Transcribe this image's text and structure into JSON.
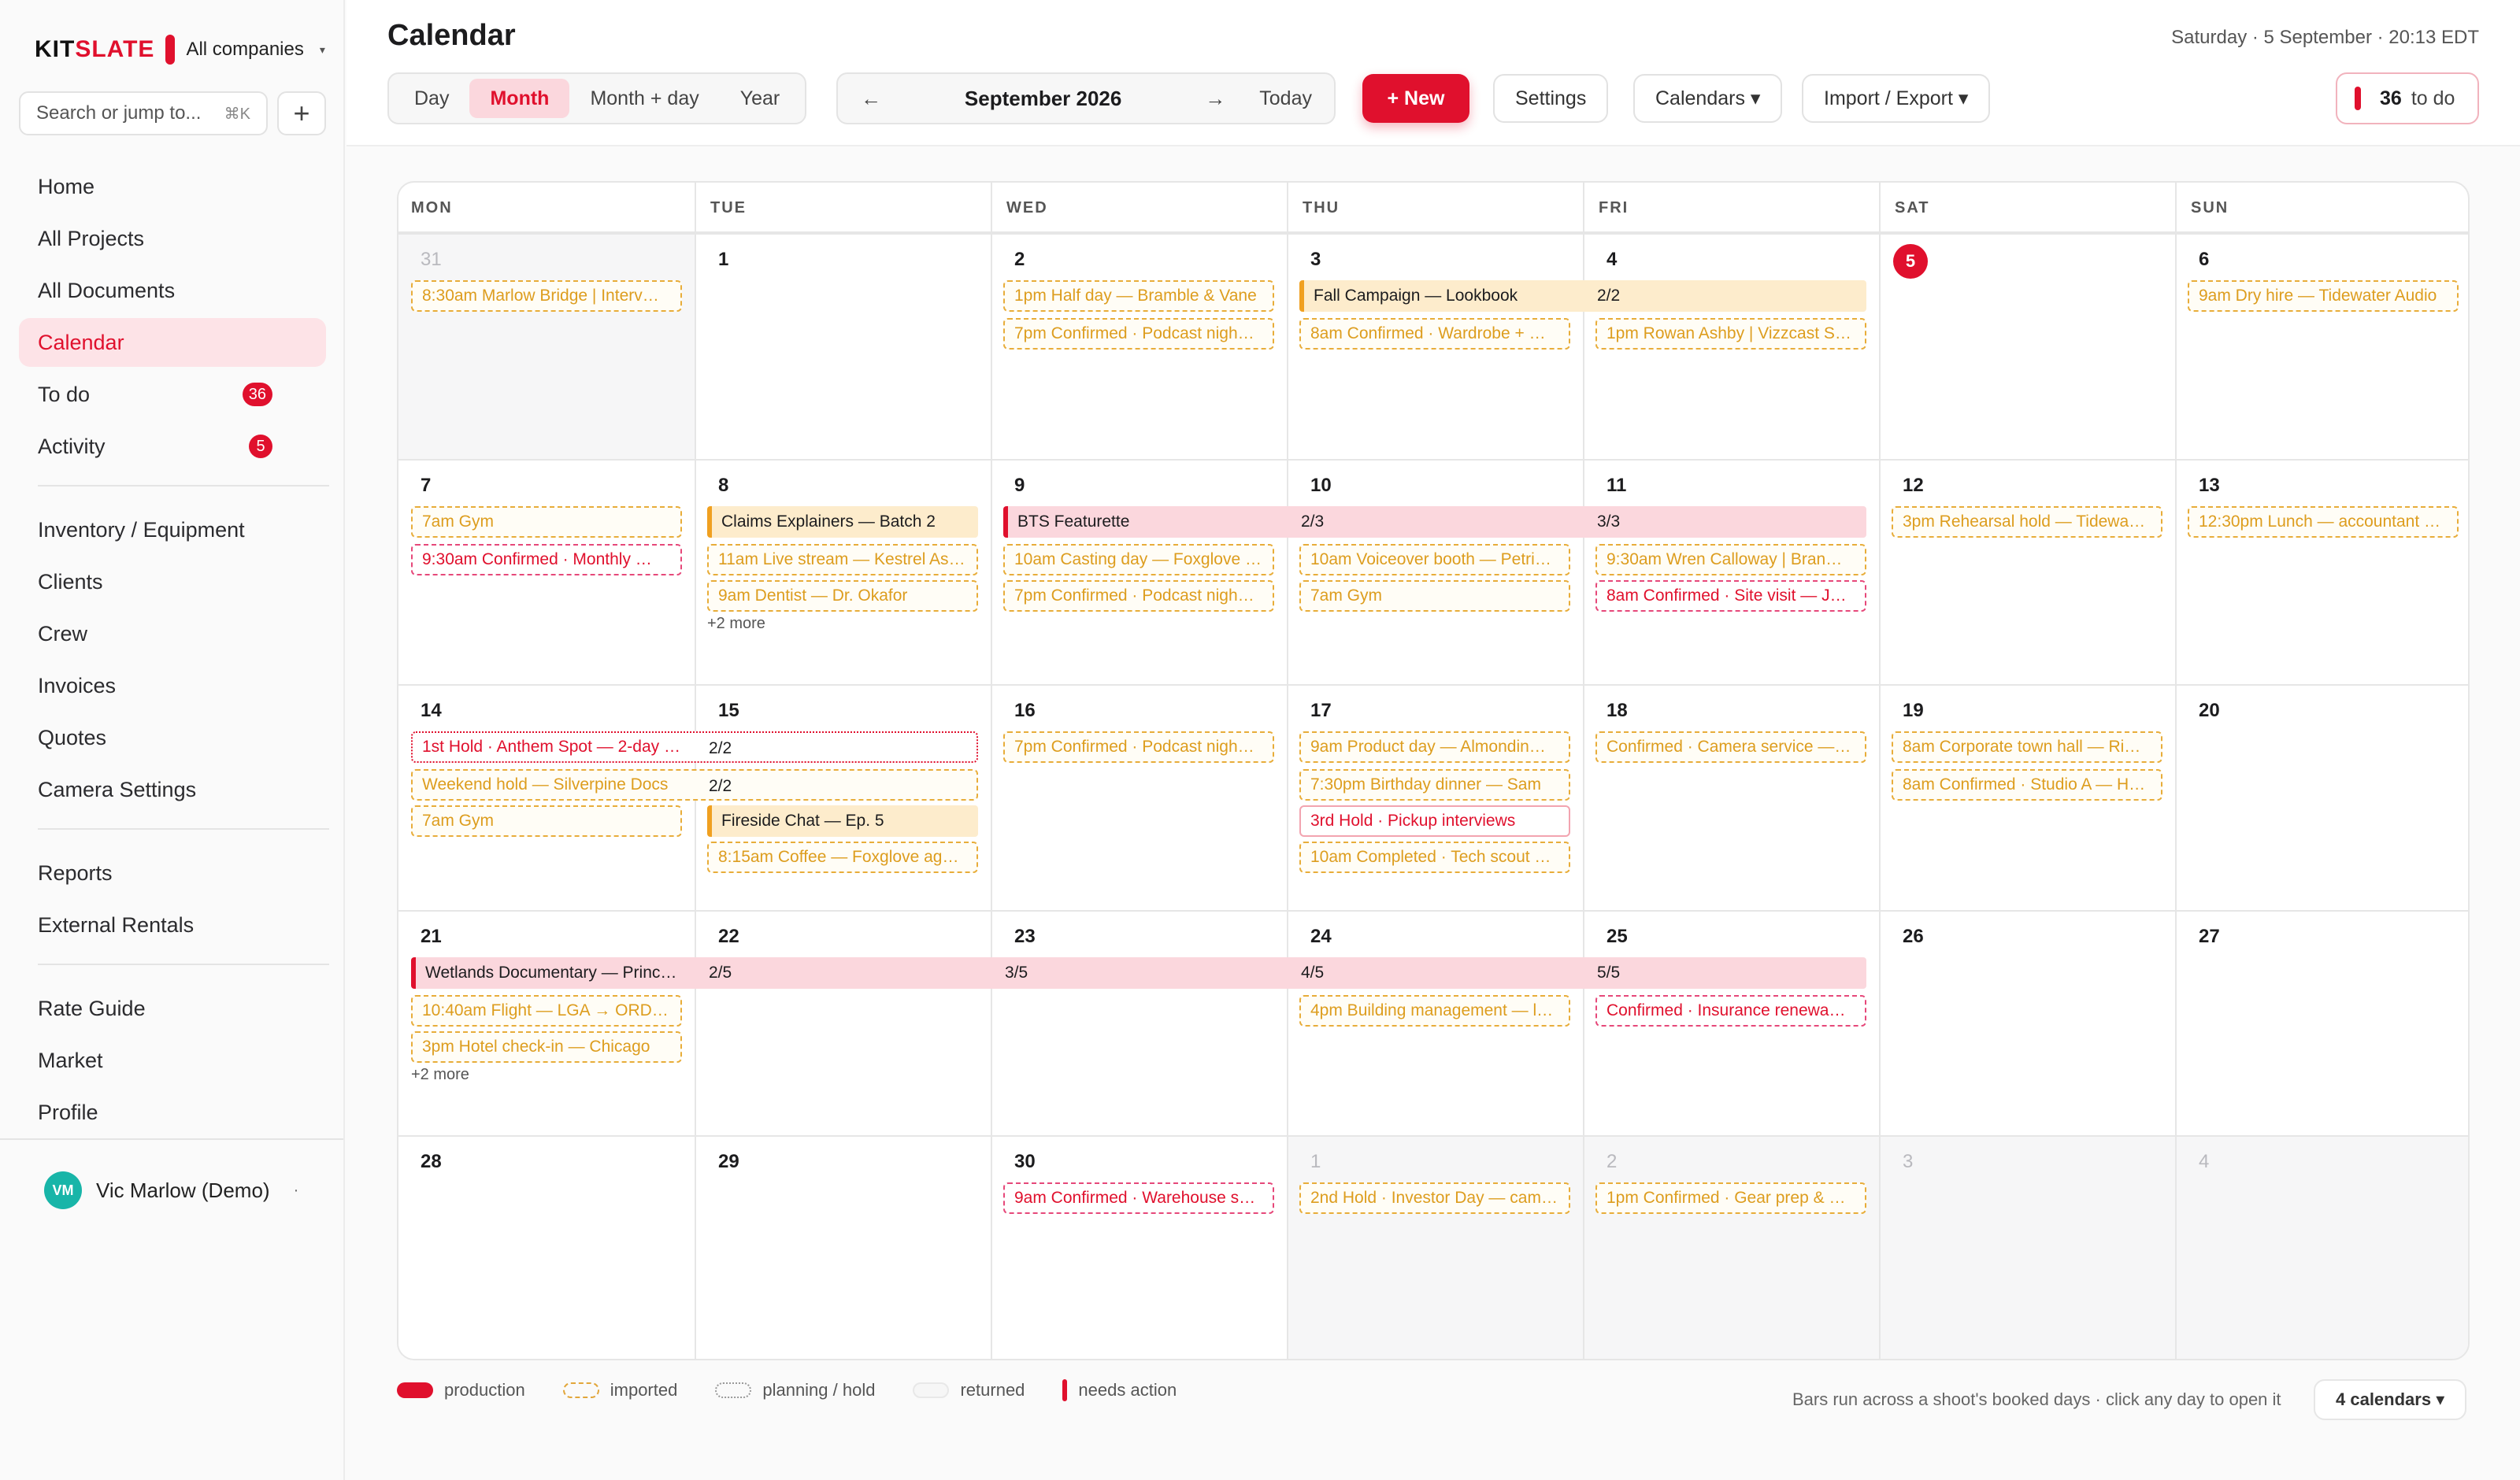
{
  "brand": {
    "logo_a": "KIT",
    "logo_b": "SLATE",
    "company": "All companies",
    "caret": "▾"
  },
  "search": {
    "placeholder": "Search or jump to...",
    "shortcut": "⌘K"
  },
  "nav": {
    "group1": [
      {
        "label": "Home"
      },
      {
        "label": "All Projects"
      },
      {
        "label": "All Documents"
      },
      {
        "label": "Calendar",
        "active": true
      },
      {
        "label": "To do",
        "badge": "36"
      },
      {
        "label": "Activity",
        "badge": "5"
      }
    ],
    "group2": [
      {
        "label": "Inventory / Equipment"
      },
      {
        "label": "Clients"
      },
      {
        "label": "Crew"
      },
      {
        "label": "Invoices"
      },
      {
        "label": "Quotes"
      },
      {
        "label": "Camera Settings"
      }
    ],
    "group3": [
      {
        "label": "Reports"
      },
      {
        "label": "External Rentals"
      }
    ],
    "group4": [
      {
        "label": "Rate Guide"
      },
      {
        "label": "Market"
      },
      {
        "label": "Profile"
      }
    ]
  },
  "user": {
    "initials": "VM",
    "name": "Vic Marlow (Demo)",
    "menu": "·"
  },
  "header": {
    "title": "Calendar",
    "datetime": "Saturday · 5 September · 20:13 EDT",
    "views": [
      "Day",
      "Month",
      "Month + day",
      "Year"
    ],
    "active_view": "Month",
    "prev": "←",
    "next": "→",
    "month": "September 2026",
    "today": "Today",
    "new": "+ New",
    "settings": "Settings",
    "calendars": "Calendars ▾",
    "import_export": "Import / Export ▾",
    "todo_count": "36",
    "todo_label": "to do"
  },
  "calendar": {
    "dows": [
      "MON",
      "TUE",
      "WED",
      "THU",
      "FRI",
      "SAT",
      "SUN"
    ],
    "weeks": [
      [
        {
          "d": "31",
          "out": true
        },
        {
          "d": "1"
        },
        {
          "d": "2"
        },
        {
          "d": "3"
        },
        {
          "d": "4"
        },
        {
          "d": "5",
          "today": true
        },
        {
          "d": "6"
        }
      ],
      [
        {
          "d": "7"
        },
        {
          "d": "8"
        },
        {
          "d": "9"
        },
        {
          "d": "10"
        },
        {
          "d": "11"
        },
        {
          "d": "12"
        },
        {
          "d": "13"
        }
      ],
      [
        {
          "d": "14"
        },
        {
          "d": "15"
        },
        {
          "d": "16"
        },
        {
          "d": "17"
        },
        {
          "d": "18"
        },
        {
          "d": "19"
        },
        {
          "d": "20"
        }
      ],
      [
        {
          "d": "21"
        },
        {
          "d": "22"
        },
        {
          "d": "23"
        },
        {
          "d": "24"
        },
        {
          "d": "25"
        },
        {
          "d": "26"
        },
        {
          "d": "27"
        }
      ],
      [
        {
          "d": "28"
        },
        {
          "d": "29"
        },
        {
          "d": "30"
        },
        {
          "d": "1",
          "out": true
        },
        {
          "d": "2",
          "out": true
        },
        {
          "d": "3",
          "out": true
        },
        {
          "d": "4",
          "out": true
        }
      ]
    ],
    "events": [
      {
        "w": 0,
        "c": 0,
        "span": 1,
        "slot": 0,
        "t": "imp",
        "text": "8:30am Marlow Bridge | Interv…"
      },
      {
        "w": 0,
        "c": 2,
        "span": 1,
        "slot": 0,
        "t": "imp",
        "text": "1pm Half day — Bramble & Vane"
      },
      {
        "w": 0,
        "c": 2,
        "span": 1,
        "slot": 1,
        "t": "imp",
        "text": "7pm Confirmed · Podcast nigh…"
      },
      {
        "w": 0,
        "c": 3,
        "span": 2,
        "slot": 0,
        "t": "bar-y",
        "text": "Fall Campaign — Lookbook",
        "segs": [
          "2/2"
        ]
      },
      {
        "w": 0,
        "c": 3,
        "span": 1,
        "slot": 1,
        "t": "imp",
        "text": "8am Confirmed · Wardrobe + …"
      },
      {
        "w": 0,
        "c": 4,
        "span": 1,
        "slot": 1,
        "t": "imp",
        "text": "1pm Rowan Ashby | Vizzcast St…"
      },
      {
        "w": 0,
        "c": 6,
        "span": 1,
        "slot": 0,
        "t": "imp",
        "text": "9am Dry hire — Tidewater Audio"
      },
      {
        "w": 1,
        "c": 0,
        "span": 1,
        "slot": 0,
        "t": "imp",
        "text": "7am Gym"
      },
      {
        "w": 1,
        "c": 0,
        "span": 1,
        "slot": 1,
        "t": "conf",
        "text": "9:30am Confirmed · Monthly …"
      },
      {
        "w": 1,
        "c": 1,
        "span": 1,
        "slot": 0,
        "t": "bar-y",
        "text": "Claims Explainers — Batch 2"
      },
      {
        "w": 1,
        "c": 1,
        "span": 1,
        "slot": 1,
        "t": "imp",
        "text": "11am Live stream — Kestrel Ass…"
      },
      {
        "w": 1,
        "c": 1,
        "span": 1,
        "slot": 2,
        "t": "imp",
        "text": "9am Dentist — Dr. Okafor"
      },
      {
        "w": 1,
        "c": 2,
        "span": 3,
        "slot": 0,
        "t": "bar-p",
        "text": "BTS Featurette",
        "segs": [
          "2/3",
          "3/3"
        ]
      },
      {
        "w": 1,
        "c": 2,
        "span": 1,
        "slot": 1,
        "t": "imp",
        "text": "10am Casting day — Foxglove …"
      },
      {
        "w": 1,
        "c": 2,
        "span": 1,
        "slot": 2,
        "t": "imp",
        "text": "7pm Confirmed · Podcast nigh…"
      },
      {
        "w": 1,
        "c": 3,
        "span": 1,
        "slot": 1,
        "t": "imp",
        "text": "10am Voiceover booth — Petri…"
      },
      {
        "w": 1,
        "c": 3,
        "span": 1,
        "slot": 2,
        "t": "imp",
        "text": "7am Gym"
      },
      {
        "w": 1,
        "c": 4,
        "span": 1,
        "slot": 1,
        "t": "imp",
        "text": "9:30am Wren Calloway | Bran…"
      },
      {
        "w": 1,
        "c": 4,
        "span": 1,
        "slot": 2,
        "t": "conf",
        "text": "8am Confirmed · Site visit — Ja…"
      },
      {
        "w": 1,
        "c": 5,
        "span": 1,
        "slot": 0,
        "t": "imp",
        "text": "3pm Rehearsal hold — Tidewa…"
      },
      {
        "w": 1,
        "c": 6,
        "span": 1,
        "slot": 0,
        "t": "imp",
        "text": "12:30pm Lunch — accountant …"
      },
      {
        "w": 2,
        "c": 0,
        "span": 2,
        "slot": 0,
        "t": "hold",
        "text": "1st Hold · Anthem Spot — 2-day …",
        "segs": [
          "2/2"
        ]
      },
      {
        "w": 2,
        "c": 0,
        "span": 2,
        "slot": 1,
        "t": "imp",
        "text": "Weekend hold — Silverpine Docs",
        "segs": [
          "2/2"
        ]
      },
      {
        "w": 2,
        "c": 0,
        "span": 1,
        "slot": 2,
        "t": "imp",
        "text": "7am Gym"
      },
      {
        "w": 2,
        "c": 1,
        "span": 1,
        "slot": 2,
        "t": "bar-y",
        "text": "Fireside Chat — Ep. 5"
      },
      {
        "w": 2,
        "c": 1,
        "span": 1,
        "slot": 3,
        "t": "imp",
        "text": "8:15am Coffee — Foxglove ag…"
      },
      {
        "w": 2,
        "c": 2,
        "span": 1,
        "slot": 0,
        "t": "imp",
        "text": "7pm Confirmed · Podcast nigh…"
      },
      {
        "w": 2,
        "c": 3,
        "span": 1,
        "slot": 0,
        "t": "imp",
        "text": "9am Product day — Almondin…"
      },
      {
        "w": 2,
        "c": 3,
        "span": 1,
        "slot": 1,
        "t": "imp",
        "text": "7:30pm Birthday dinner — Sam"
      },
      {
        "w": 2,
        "c": 3,
        "span": 1,
        "slot": 2,
        "t": "hold-solid",
        "text": "3rd Hold · Pickup interviews"
      },
      {
        "w": 2,
        "c": 3,
        "span": 1,
        "slot": 3,
        "t": "imp",
        "text": "10am Completed · Tech scout …"
      },
      {
        "w": 2,
        "c": 4,
        "span": 1,
        "slot": 0,
        "t": "imp",
        "text": "Confirmed · Camera service — …"
      },
      {
        "w": 2,
        "c": 5,
        "span": 1,
        "slot": 0,
        "t": "imp",
        "text": "8am Corporate town hall — Ri…"
      },
      {
        "w": 2,
        "c": 5,
        "span": 1,
        "slot": 1,
        "t": "imp",
        "text": "8am Confirmed · Studio A — H…"
      },
      {
        "w": 3,
        "c": 0,
        "span": 5,
        "slot": 0,
        "t": "bar-p",
        "text": "Wetlands Documentary — Princ…",
        "segs": [
          "2/5",
          "3/5",
          "4/5",
          "5/5"
        ]
      },
      {
        "w": 3,
        "c": 0,
        "span": 1,
        "slot": 1,
        "t": "imp",
        "text": "10:40am Flight — LGA → ORD …"
      },
      {
        "w": 3,
        "c": 0,
        "span": 1,
        "slot": 2,
        "t": "imp",
        "text": "3pm Hotel check-in — Chicago"
      },
      {
        "w": 3,
        "c": 3,
        "span": 1,
        "slot": 1,
        "t": "imp",
        "text": "4pm Building management — l…"
      },
      {
        "w": 3,
        "c": 4,
        "span": 1,
        "slot": 1,
        "t": "conf",
        "text": "Confirmed · Insurance renewa…"
      },
      {
        "w": 4,
        "c": 2,
        "span": 1,
        "slot": 0,
        "t": "conf",
        "text": "9am Confirmed · Warehouse s…"
      },
      {
        "w": 4,
        "c": 3,
        "span": 1,
        "slot": 0,
        "t": "imp",
        "text": "2nd Hold · Investor Day — cam…"
      },
      {
        "w": 4,
        "c": 4,
        "span": 1,
        "slot": 0,
        "t": "imp",
        "text": "1pm Confirmed · Gear prep & …"
      }
    ],
    "more": [
      {
        "w": 1,
        "c": 1,
        "text": "+2 more"
      },
      {
        "w": 3,
        "c": 0,
        "text": "+2 more"
      }
    ]
  },
  "legend": {
    "items": [
      "production",
      "imported",
      "planning / hold",
      "returned",
      "needs action"
    ],
    "hint": "Bars run across a shoot's booked days · click any day to open it",
    "count": "4 calendars ▾"
  },
  "colors": {
    "accent": "#e0102d",
    "imported": "#e8ad3a",
    "today": "#e0102d"
  }
}
